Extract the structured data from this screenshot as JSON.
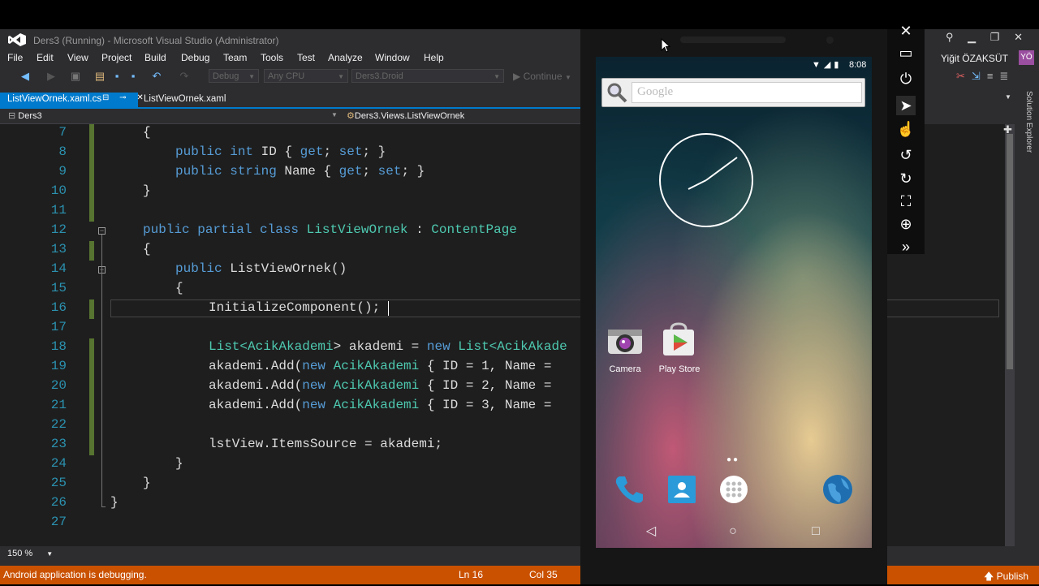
{
  "window": {
    "title": "Ders3 (Running) - Microsoft Visual Studio (Administrator)",
    "user_name": "Yiğit ÖZAKSÜT",
    "user_initials": "YÖ"
  },
  "menu": [
    "File",
    "Edit",
    "View",
    "Project",
    "Build",
    "Debug",
    "Team",
    "Tools",
    "Test",
    "Analyze",
    "Window",
    "Help"
  ],
  "toolbar": {
    "config": "Debug",
    "platform": "Any CPU",
    "project": "Ders3.Droid",
    "continue_label": "Continue"
  },
  "tabs": {
    "active": "ListViewOrnek.xaml.cs",
    "active_icons": "⊟ ⊸ ✕",
    "second": "ListViewOrnek.xaml"
  },
  "navbar": {
    "project": "Ders3",
    "type": "Ders3.Views.ListViewOrnek"
  },
  "editor": {
    "line_numbers": [
      "7",
      "8",
      "9",
      "10",
      "11",
      "12",
      "13",
      "14",
      "15",
      "16",
      "17",
      "18",
      "19",
      "20",
      "21",
      "22",
      "23",
      "24",
      "25",
      "26",
      "27"
    ],
    "lines": {
      "l7": "{",
      "l8a": "public ",
      "l8b": "int",
      "l8c": " ID { ",
      "l8d": "get",
      "l8e": "; ",
      "l8f": "set",
      "l8g": "; }",
      "l9a": "public ",
      "l9b": "string",
      "l9c": " Name { ",
      "l9d": "get",
      "l9e": "; ",
      "l9f": "set",
      "l9g": "; }",
      "l10": "}",
      "l12a": "public partial class ",
      "l12b": "ListViewOrnek",
      "l12c": " : ",
      "l12d": "ContentPage",
      "l13": "{",
      "l14a": "public ",
      "l14b": "ListViewOrnek()",
      "l15": "{",
      "l16": "InitializeComponent();",
      "l18a": "List<",
      "l18b": "AcikAkademi",
      "l18c": "> akademi = ",
      "l18d": "new ",
      "l18e": "List<",
      "l18f": "AcikAkade",
      "l19a": "akademi.Add(",
      "l19b": "new ",
      "l19c": "AcikAkademi",
      "l19d": " { ID = 1, Name = ",
      "l20a": "akademi.Add(",
      "l20b": "new ",
      "l20c": "AcikAkademi",
      "l20d": " { ID = 2, Name = ",
      "l21a": "akademi.Add(",
      "l21b": "new ",
      "l21c": "AcikAkademi",
      "l21d": " { ID = 3, Name = ",
      "l23": "lstView.ItemsSource = akademi;",
      "l24": "}",
      "l25": "}",
      "l26": "}"
    },
    "zoom": "150 %"
  },
  "status": {
    "message": "Android application is debugging.",
    "ln": "Ln 16",
    "col": "Col 35",
    "publish": "Publish"
  },
  "emulator": {
    "time": "8:08",
    "search_placeholder": "Google",
    "apps": [
      {
        "label": "Camera",
        "icon": "camera-icon"
      },
      {
        "label": "Play Store",
        "icon": "play-store-icon"
      }
    ],
    "dock": [
      "phone-icon",
      "contacts-icon",
      "app-drawer-icon",
      "browser-icon"
    ],
    "nav": [
      "back-icon",
      "home-icon",
      "recents-icon"
    ]
  },
  "side_panel": {
    "solution_explorer": "Solution Explorer"
  },
  "colors": {
    "accent": "#007acc",
    "status_bar": "#ca5100",
    "keyword": "#569cd6",
    "type": "#4ec9b0",
    "line_number": "#2b91af"
  }
}
